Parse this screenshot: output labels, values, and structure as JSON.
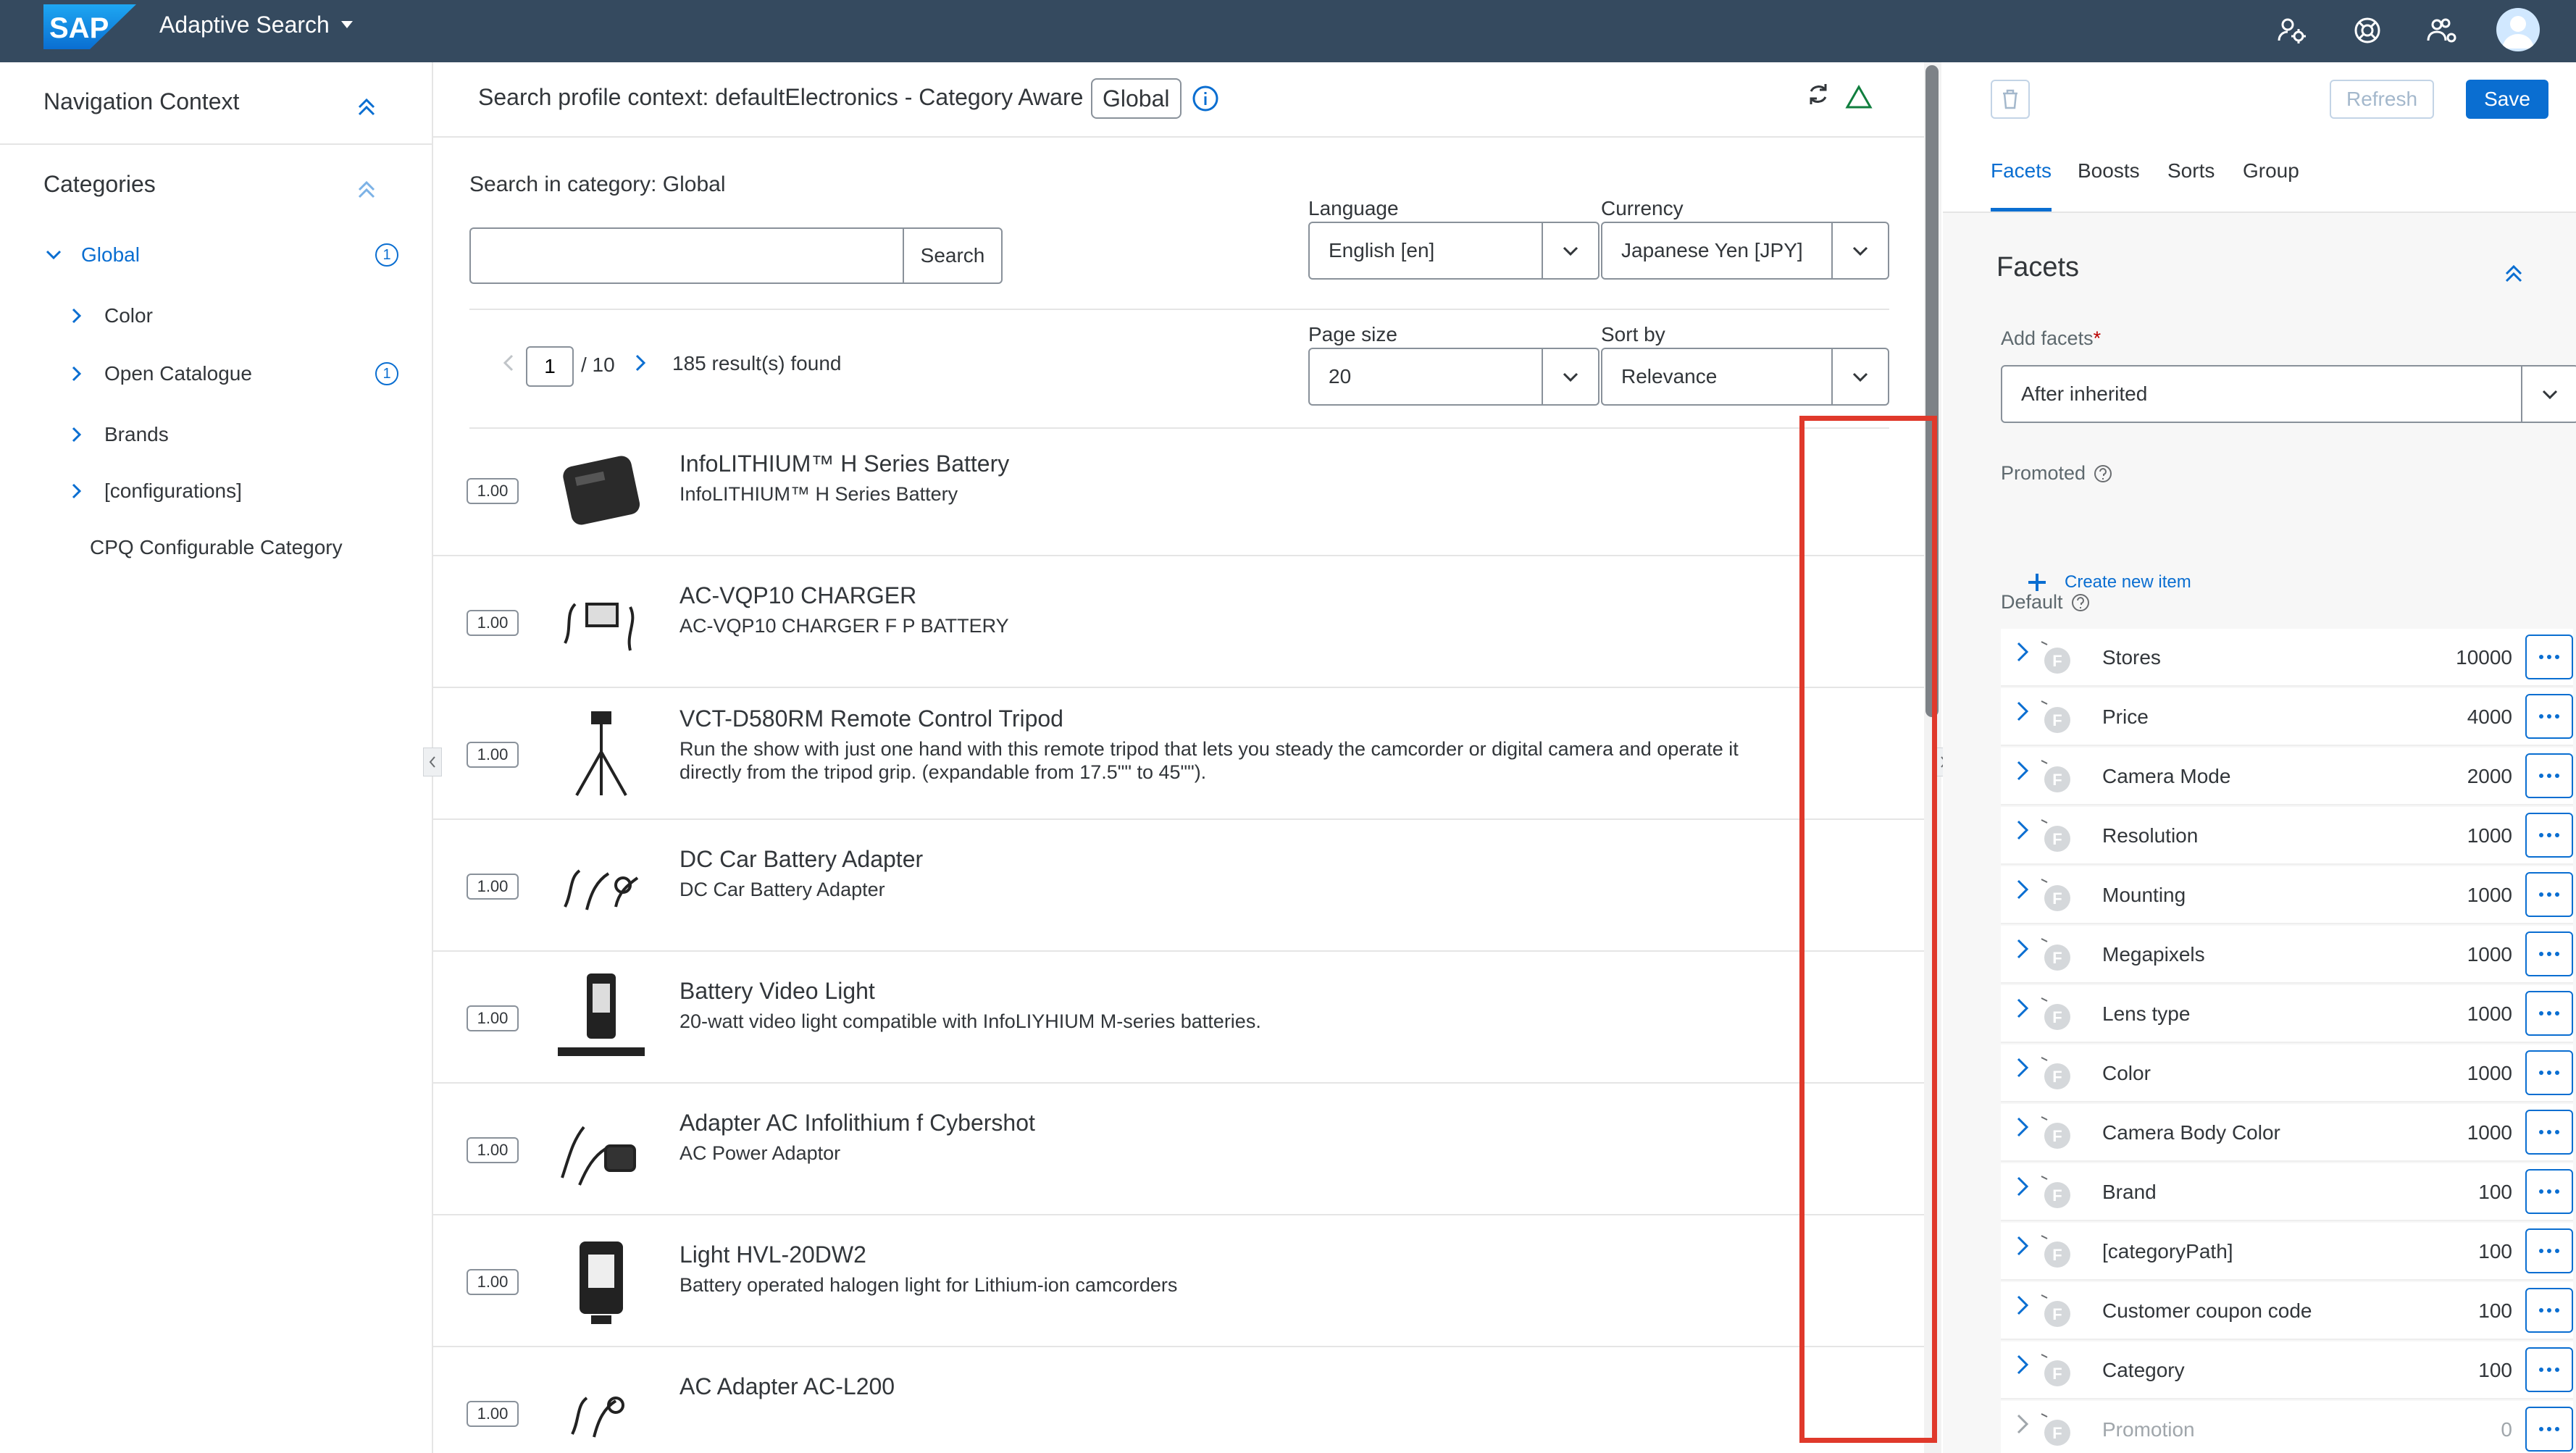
{
  "shell": {
    "logo_text": "SAP",
    "app_title": "Adaptive Search"
  },
  "nav": {
    "title": "Navigation Context",
    "categories_title": "Categories",
    "tree": [
      {
        "label": "Global",
        "badge": "1",
        "expanded": true
      },
      {
        "label": "Color",
        "badge": ""
      },
      {
        "label": "Open Catalogue",
        "badge": "1"
      },
      {
        "label": "Brands",
        "badge": ""
      },
      {
        "label": "[configurations]",
        "badge": ""
      },
      {
        "label": "CPQ Configurable Category",
        "badge": ""
      }
    ]
  },
  "center": {
    "context_text": "Search profile context: defaultElectronics - Category Aware",
    "context_chip": "Global",
    "search_in_category": "Search in category: Global",
    "search_input_value": "",
    "search_button": "Search",
    "language_label": "Language",
    "language_value": "English [en]",
    "currency_label": "Currency",
    "currency_value": "Japanese Yen [JPY]",
    "page_size_label": "Page size",
    "page_size_value": "20",
    "sort_by_label": "Sort by",
    "sort_by_value": "Relevance",
    "pager_page": "1",
    "pager_total": "/ 10",
    "result_count": "185 result(s) found"
  },
  "results": [
    {
      "score": "1.00",
      "title": "InfoLITHIUM™ H Series Battery",
      "desc": "InfoLITHIUM™ H Series Battery",
      "thumb": "battery"
    },
    {
      "score": "1.00",
      "title": "AC-VQP10 CHARGER",
      "desc": "AC-VQP10 CHARGER F P BATTERY",
      "thumb": "charger"
    },
    {
      "score": "1.00",
      "title": "VCT-D580RM Remote Control Tripod",
      "desc": "Run the show with just one hand with this remote tripod that lets you steady the camcorder or digital camera and operate it directly from the tripod grip. (expandable from 17.5\"\" to 45\"\").",
      "thumb": "tripod"
    },
    {
      "score": "1.00",
      "title": "DC Car Battery Adapter",
      "desc": "DC Car Battery Adapter",
      "thumb": "cables"
    },
    {
      "score": "1.00",
      "title": "Battery Video Light",
      "desc": "20-watt video light compatible with InfoLIYHIUM M-series batteries.",
      "thumb": "videolight"
    },
    {
      "score": "1.00",
      "title": "Adapter AC Infolithium f Cybershot",
      "desc": "AC Power Adaptor",
      "thumb": "adapter"
    },
    {
      "score": "1.00",
      "title": "Light HVL-20DW2",
      "desc": "Battery operated halogen light for Lithium-ion camcorders",
      "thumb": "light"
    },
    {
      "score": "1.00",
      "title": "AC Adapter AC-L200",
      "desc": "",
      "thumb": "cables"
    }
  ],
  "right": {
    "refresh_label": "Refresh",
    "save_label": "Save",
    "tabs": [
      "Facets",
      "Boosts",
      "Sorts",
      "Group"
    ],
    "facets_title": "Facets",
    "add_facets_label": "Add facets",
    "add_facets_value": "After inherited",
    "promoted_label": "Promoted",
    "create_new_item": "Create new item",
    "default_label": "Default",
    "facets": [
      {
        "name": "Stores",
        "priority": "10000"
      },
      {
        "name": "Price",
        "priority": "4000"
      },
      {
        "name": "Camera Mode",
        "priority": "2000"
      },
      {
        "name": "Resolution",
        "priority": "1000"
      },
      {
        "name": "Mounting",
        "priority": "1000"
      },
      {
        "name": "Megapixels",
        "priority": "1000"
      },
      {
        "name": "Lens type",
        "priority": "1000"
      },
      {
        "name": "Color",
        "priority": "1000"
      },
      {
        "name": "Camera Body Color",
        "priority": "1000"
      },
      {
        "name": "Brand",
        "priority": "100"
      },
      {
        "name": "[categoryPath]",
        "priority": "100"
      },
      {
        "name": "Customer coupon code",
        "priority": "100"
      },
      {
        "name": "Category",
        "priority": "100"
      },
      {
        "name": "Promotion",
        "priority": "0"
      }
    ],
    "facet_badge_letter": "F"
  },
  "colors": {
    "shell": "#354a5f",
    "accent": "#0a6ed1",
    "highlight_box": "#e0392b"
  }
}
